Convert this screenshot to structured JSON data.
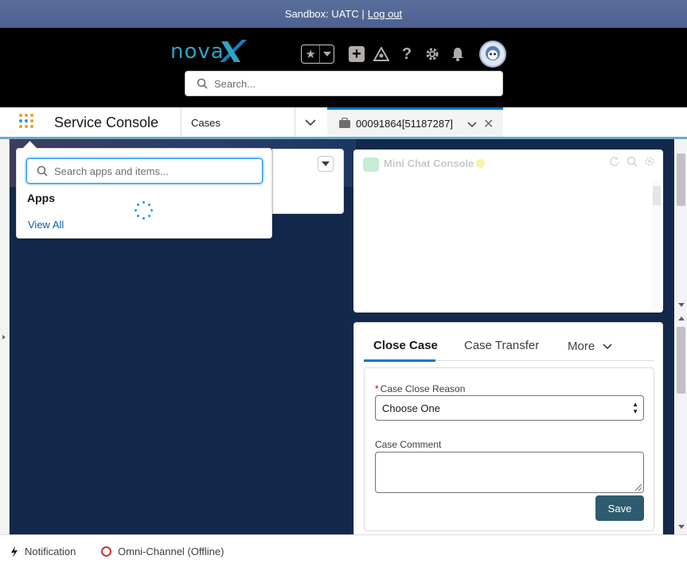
{
  "sandbox_bar": {
    "text": "Sandbox: UATC |",
    "logout": "Log out"
  },
  "header": {
    "logo_text": "nova",
    "search_placeholder": "Search...",
    "icons": [
      "star-icon",
      "chevron-down-icon",
      "plus-icon",
      "trailhead-icon",
      "help-icon",
      "gear-icon",
      "bell-icon",
      "avatar"
    ]
  },
  "nav": {
    "app_name": "Service Console",
    "item": "Cases",
    "workspace_tab": {
      "label": "00091864[51187287]",
      "icon": "case-briefcase-icon"
    }
  },
  "app_launcher": {
    "search_placeholder": "Search apps and items...",
    "apps_heading": "Apps",
    "view_all": "View All"
  },
  "mini_chat": {
    "title": "Mini Chat Console"
  },
  "case_panel": {
    "tabs": [
      {
        "label": "Close Case",
        "active": true
      },
      {
        "label": "Case Transfer",
        "active": false
      },
      {
        "label": "More",
        "active": false
      }
    ],
    "reason_label": "Case Close Reason",
    "reason_value": "Choose One",
    "comment_label": "Case Comment",
    "save_label": "Save"
  },
  "utility_bar": {
    "notification": "Notification",
    "omni": "Omni-Channel (Offline)"
  },
  "colors": {
    "brand_blue": "#0176d3",
    "save_button": "#2e5c6e",
    "background_navy": "#13294b",
    "omni_offline": "#c23934"
  }
}
